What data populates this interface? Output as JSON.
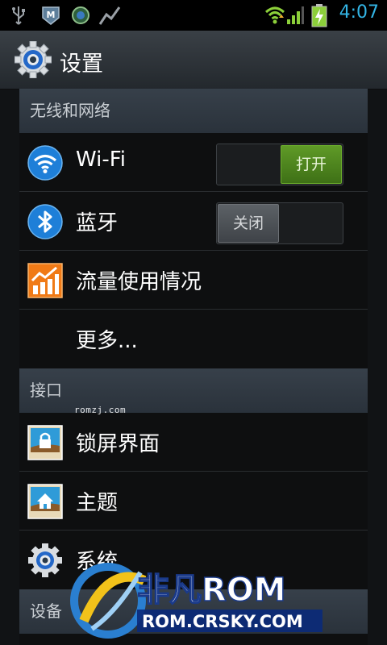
{
  "status_bar": {
    "time": "4:07",
    "icons": [
      "usb-icon",
      "m-badge-icon",
      "s-badge-icon",
      "chart-icon",
      "wifi-signal-icon",
      "cell-signal-icon",
      "battery-charging-icon"
    ]
  },
  "title_bar": {
    "title": "设置",
    "icon": "gear-icon"
  },
  "sections": [
    {
      "header": "无线和网络",
      "rows": [
        {
          "label": "Wi-Fi",
          "icon": "wifi-icon",
          "toggle": "打开",
          "toggle_state": "on"
        },
        {
          "label": "蓝牙",
          "icon": "bluetooth-icon",
          "toggle": "关闭",
          "toggle_state": "off"
        },
        {
          "label": "流量使用情况",
          "icon": "data-usage-icon"
        },
        {
          "label": "更多..."
        }
      ]
    },
    {
      "header": "接口",
      "watermark": "romzj.com",
      "rows": [
        {
          "label": "锁屏界面",
          "icon": "lockscreen-icon"
        },
        {
          "label": "主题",
          "icon": "theme-icon"
        },
        {
          "label": "系统",
          "icon": "system-gear-icon"
        }
      ]
    },
    {
      "header": "设备"
    }
  ],
  "overlay_logo": {
    "brand": "非凡ROM",
    "url": "ROM.CRSKY.COM"
  },
  "colors": {
    "accent": "#33b5e5",
    "toggle_on": "#4f8a1f",
    "toggle_off": "#4a4f54"
  }
}
